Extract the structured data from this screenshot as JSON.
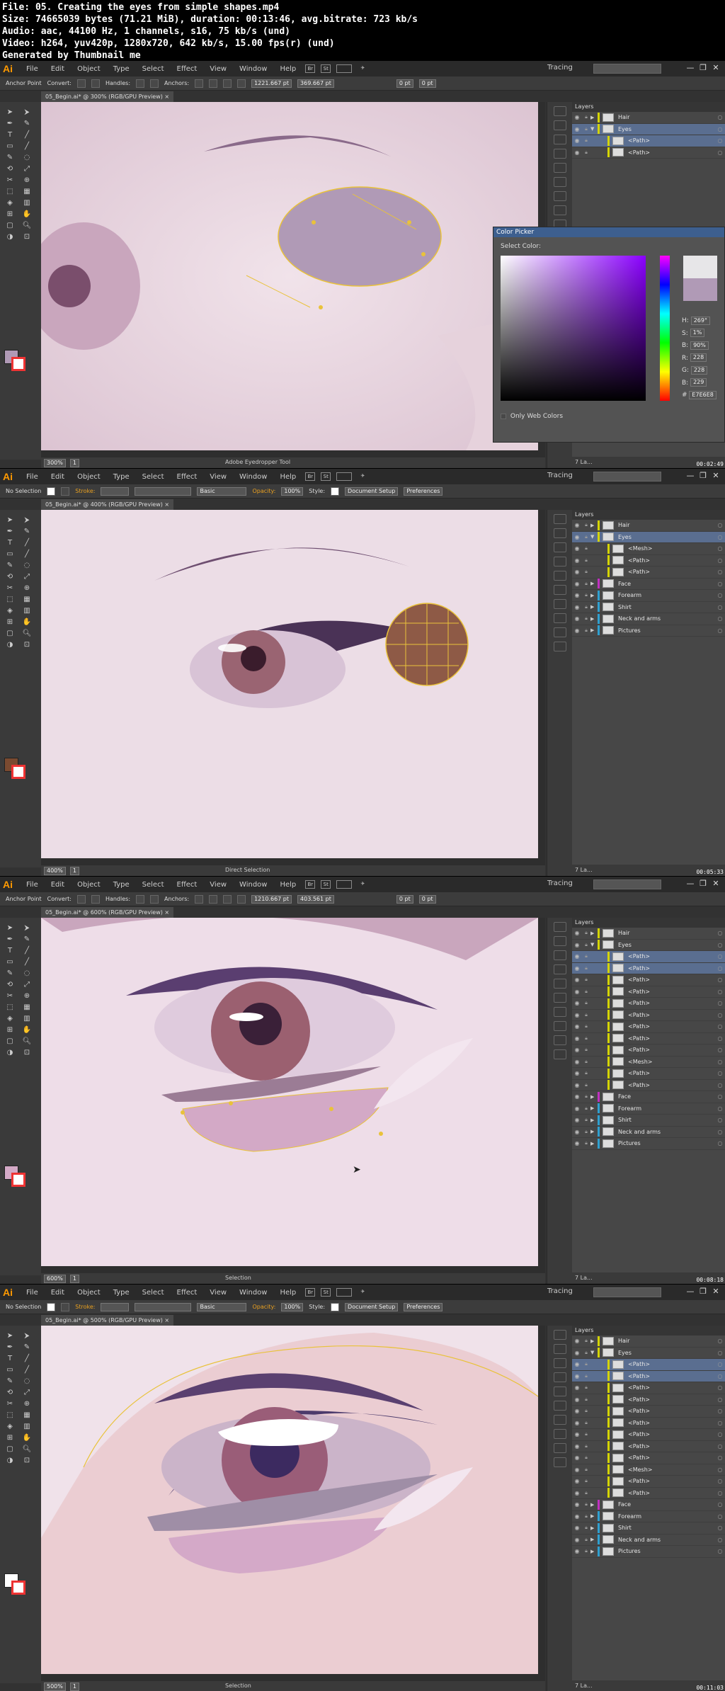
{
  "file_info": {
    "line1": "File: 05. Creating the eyes from simple shapes.mp4",
    "line2": "Size: 74665039 bytes (71.21 MiB), duration: 00:13:46, avg.bitrate: 723 kb/s",
    "line3": "Audio: aac, 44100 Hz, 1 channels, s16, 75 kb/s (und)",
    "line4": "Video: h264, yuv420p, 1280x720, 642 kb/s, 15.00 fps(r) (und)",
    "line5": "Generated by Thumbnail me"
  },
  "app": {
    "logo": "Ai",
    "menus": [
      "File",
      "Edit",
      "Object",
      "Type",
      "Select",
      "Effect",
      "View",
      "Window",
      "Help"
    ],
    "bridge_label": "Br",
    "st_label": "St",
    "workspace": "Tracing",
    "colors": {
      "accent": "#ff9a00",
      "selection": "#5a6e90",
      "path_yellow": "#e9c23a"
    }
  },
  "layers_panel": {
    "title": "Layers",
    "rows_a": [
      "Hair",
      "Eyes",
      "<Path>",
      "<Path>"
    ],
    "rows_b": [
      "Hair",
      "Eyes",
      "<Mesh>",
      "<Path>",
      "<Path>",
      "Face",
      "Forearm",
      "Shirt",
      "Neck and arms",
      "Pictures"
    ],
    "rows_c": [
      "Hair",
      "Eyes",
      "<Path>",
      "<Path>",
      "<Path>",
      "<Path>",
      "<Path>",
      "<Path>",
      "<Path>",
      "<Path>",
      "<Path>",
      "<Mesh>",
      "<Path>",
      "<Path>",
      "Face",
      "Forearm",
      "Shirt",
      "Neck and arms",
      "Pictures"
    ],
    "rows_d": [
      "Hair",
      "Eyes",
      "<Path>",
      "<Path>",
      "<Path>",
      "<Path>",
      "<Path>",
      "<Path>",
      "<Path>",
      "<Path>",
      "<Path>",
      "<Mesh>",
      "<Path>",
      "<Path>",
      "Face",
      "Forearm",
      "Shirt",
      "Neck and arms",
      "Pictures"
    ],
    "footer": "7 La..."
  },
  "panels": [
    {
      "tab": "05_Begin.ai* @ 300% (RGB/GPU Preview)",
      "ctrl": {
        "left": "Anchor Point",
        "convert": "Convert:",
        "handles": "Handles:",
        "anchors": "Anchors:",
        "x": "1221.667 pt",
        "y": "369.667 pt",
        "w": "0 pt",
        "h": "0 pt"
      },
      "zoom": "300%",
      "page": "1",
      "status": "Adobe Eyedropper Tool",
      "timestamp": "00:02:49"
    },
    {
      "tab": "05_Begin.ai* @ 400% (RGB/GPU Preview)",
      "ctrl": {
        "left": "No Selection",
        "stroke": "Stroke:",
        "basic": "Basic",
        "opacity_label": "Opacity:",
        "opacity": "100%",
        "style": "Style:",
        "doc_setup": "Document Setup",
        "prefs": "Preferences"
      },
      "zoom": "400%",
      "page": "1",
      "status": "Direct Selection",
      "timestamp": "00:05:33"
    },
    {
      "tab": "05_Begin.ai* @ 600% (RGB/GPU Preview)",
      "ctrl": {
        "left": "Anchor Point",
        "convert": "Convert:",
        "handles": "Handles:",
        "anchors": "Anchors:",
        "x": "1210.667 pt",
        "y": "403.561 pt",
        "w": "0 pt",
        "h": "0 pt"
      },
      "zoom": "600%",
      "page": "1",
      "status": "Selection",
      "timestamp": "00:08:18"
    },
    {
      "tab": "05_Begin.ai* @ 500% (RGB/GPU Preview)",
      "ctrl": {
        "left": "No Selection",
        "stroke": "Stroke:",
        "basic": "Basic",
        "opacity_label": "Opacity:",
        "opacity": "100%",
        "style": "Style:",
        "doc_setup": "Document Setup",
        "prefs": "Preferences"
      },
      "zoom": "500%",
      "page": "1",
      "status": "Selection",
      "timestamp": "00:11:03"
    }
  ],
  "color_picker": {
    "title": "Color Picker",
    "select_label": "Select Color:",
    "h_label": "H:",
    "h": "269°",
    "s_label": "S:",
    "s": "1%",
    "b_label": "B:",
    "b": "90%",
    "r_label": "R:",
    "r": "228",
    "g_label": "G:",
    "g": "228",
    "bb_label": "B:",
    "bb": "229",
    "hex_label": "#",
    "hex": "E7E6E8",
    "only_web": "Only Web Colors"
  }
}
